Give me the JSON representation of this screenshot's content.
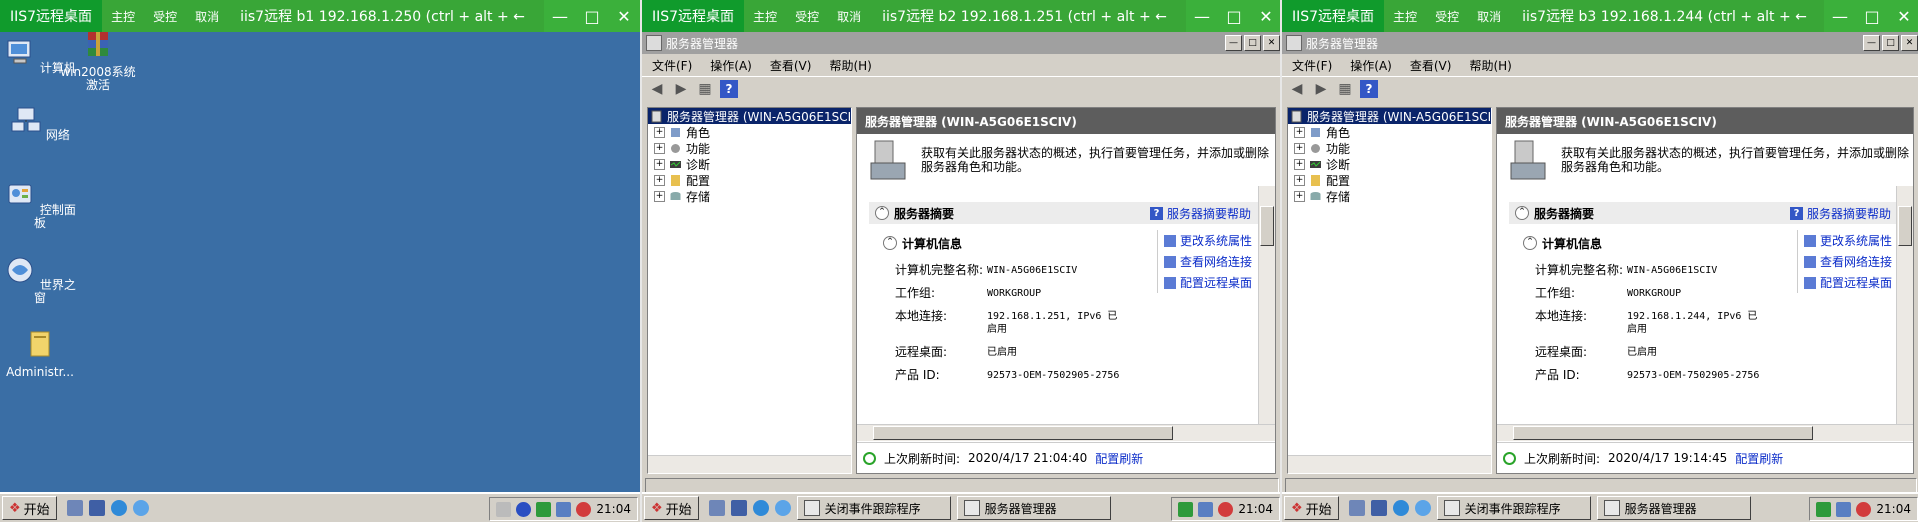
{
  "common": {
    "app_name": "IIS7远程桌面",
    "btn_main": "主控",
    "btn_controlled": "受控",
    "btn_cancel": "取消",
    "ctrl_min": "—",
    "ctrl_max": "□",
    "ctrl_close": "✕",
    "start_label": "开始",
    "colors": {
      "titlebar": "#39a637",
      "desktop": "#3a6ea5",
      "taskbar": "#d4d0c8",
      "link": "#0b2cc9"
    }
  },
  "panes": [
    {
      "info": "iis7远程   b1   192.168.1.250   (ctrl + alt + ←",
      "desktop_icons": [
        "计算机",
        "win2008系统激活",
        "网络",
        "控制面板",
        "世界之窗",
        "Administr..."
      ],
      "clock": "21:04"
    },
    {
      "info": "iis7远程   b2   192.168.1.251   (ctrl + alt + ←",
      "window_title": "服务器管理器",
      "menu": [
        "文件(F)",
        "操作(A)",
        "查看(V)",
        "帮助(H)"
      ],
      "tree_root": "服务器管理器 (WIN-A5G06E1SCI",
      "tree_items": [
        "角色",
        "功能",
        "诊断",
        "配置",
        "存储"
      ],
      "content_title": "服务器管理器 (WIN-A5G06E1SCIV)",
      "intro": "获取有关此服务器状态的概述，执行首要管理任务，并添加或删除服务器角色和功能。",
      "summary_title": "服务器摘要",
      "summary_help": "服务器摘要帮助",
      "computer_info_title": "计算机信息",
      "fields": [
        {
          "label": "计算机完整名称:",
          "value": "WIN-A5G06E1SCIV"
        },
        {
          "label": "工作组:",
          "value": "WORKGROUP"
        },
        {
          "label": "本地连接:",
          "value": "192.168.1.251, IPv6 已启用"
        },
        {
          "label": "远程桌面:",
          "value": "已启用"
        },
        {
          "label": "产品 ID:",
          "value": "92573-OEM-7502905-2756"
        }
      ],
      "actions": [
        "更改系统属性",
        "查看网络连接",
        "配置远程桌面"
      ],
      "last_refresh_label": "上次刷新时间:",
      "last_refresh": "2020/4/17 21:04:40",
      "refresh_link": "配置刷新",
      "tasks": [
        "关闭事件跟踪程序",
        "服务器管理器"
      ],
      "clock": "21:04"
    },
    {
      "info": "iis7远程   b3   192.168.1.244   (ctrl + alt + ←",
      "window_title": "服务器管理器",
      "menu": [
        "文件(F)",
        "操作(A)",
        "查看(V)",
        "帮助(H)"
      ],
      "tree_root": "服务器管理器 (WIN-A5G06E1SCI",
      "tree_items": [
        "角色",
        "功能",
        "诊断",
        "配置",
        "存储"
      ],
      "content_title": "服务器管理器 (WIN-A5G06E1SCIV)",
      "intro": "获取有关此服务器状态的概述，执行首要管理任务，并添加或删除服务器角色和功能。",
      "summary_title": "服务器摘要",
      "summary_help": "服务器摘要帮助",
      "computer_info_title": "计算机信息",
      "fields": [
        {
          "label": "计算机完整名称:",
          "value": "WIN-A5G06E1SCIV"
        },
        {
          "label": "工作组:",
          "value": "WORKGROUP"
        },
        {
          "label": "本地连接:",
          "value": "192.168.1.244, IPv6 已启用"
        },
        {
          "label": "远程桌面:",
          "value": "已启用"
        },
        {
          "label": "产品 ID:",
          "value": "92573-OEM-7502905-2756"
        }
      ],
      "actions": [
        "更改系统属性",
        "查看网络连接",
        "配置远程桌面"
      ],
      "last_refresh_label": "上次刷新时间:",
      "last_refresh": "2020/4/17 19:14:45",
      "refresh_link": "配置刷新",
      "tasks": [
        "关闭事件跟踪程序",
        "服务器管理器"
      ],
      "clock": "21:04"
    }
  ]
}
